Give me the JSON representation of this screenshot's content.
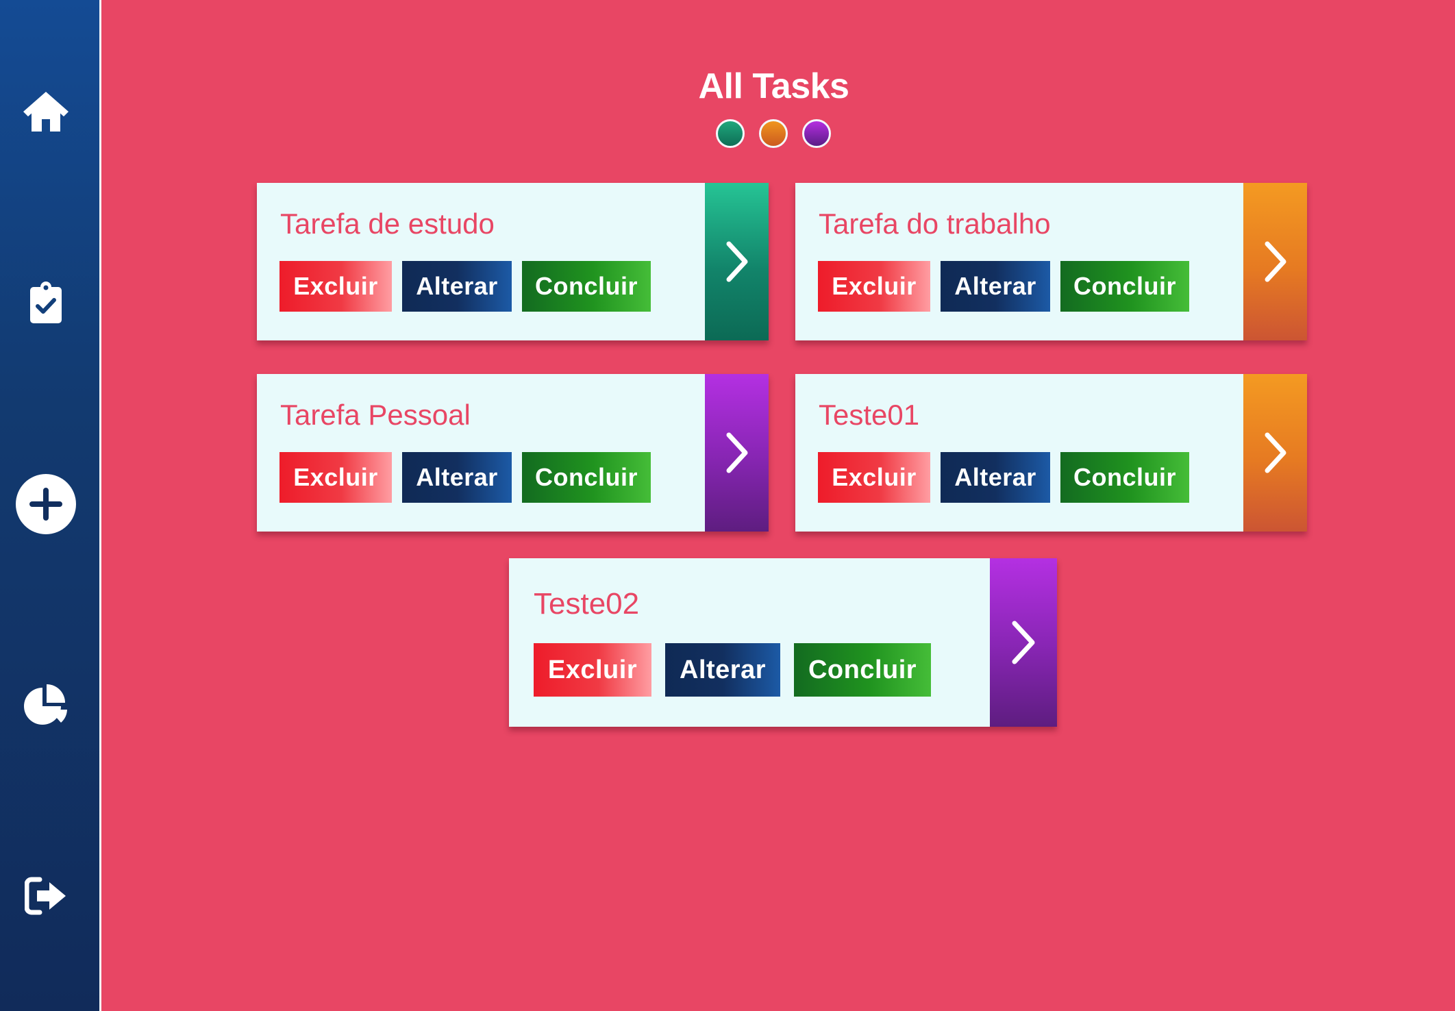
{
  "sidebar": {
    "items": [
      {
        "icon": "home-icon"
      },
      {
        "icon": "clipboard-check-icon"
      },
      {
        "icon": "plus-circle-icon"
      },
      {
        "icon": "pie-chart-icon"
      },
      {
        "icon": "sign-out-icon"
      }
    ]
  },
  "main": {
    "title": "All Tasks",
    "filters": [
      {
        "color": "#1a9a74"
      },
      {
        "color": "#e8851f"
      },
      {
        "color": "#9a28cc"
      }
    ]
  },
  "tasks": [
    {
      "title": "Tarefa de estudo",
      "delete_label": "Excluir",
      "edit_label": "Alterar",
      "complete_label": "Concluir",
      "category_color": "green"
    },
    {
      "title": "Tarefa do trabalho",
      "delete_label": "Excluir",
      "edit_label": "Alterar",
      "complete_label": "Concluir",
      "category_color": "orange"
    },
    {
      "title": "Tarefa Pessoal",
      "delete_label": "Excluir",
      "edit_label": "Alterar",
      "complete_label": "Concluir",
      "category_color": "purple"
    },
    {
      "title": "Teste01",
      "delete_label": "Excluir",
      "edit_label": "Alterar",
      "complete_label": "Concluir",
      "category_color": "orange"
    },
    {
      "title": "Teste02",
      "delete_label": "Excluir",
      "edit_label": "Alterar",
      "complete_label": "Concluir",
      "category_color": "purple"
    }
  ],
  "colors": {
    "background": "#e84664",
    "sidebar": "#123a70",
    "card": "#e8fafb",
    "delete": "#ee1c2a",
    "edit": "#122f5f",
    "complete": "#20931f"
  }
}
